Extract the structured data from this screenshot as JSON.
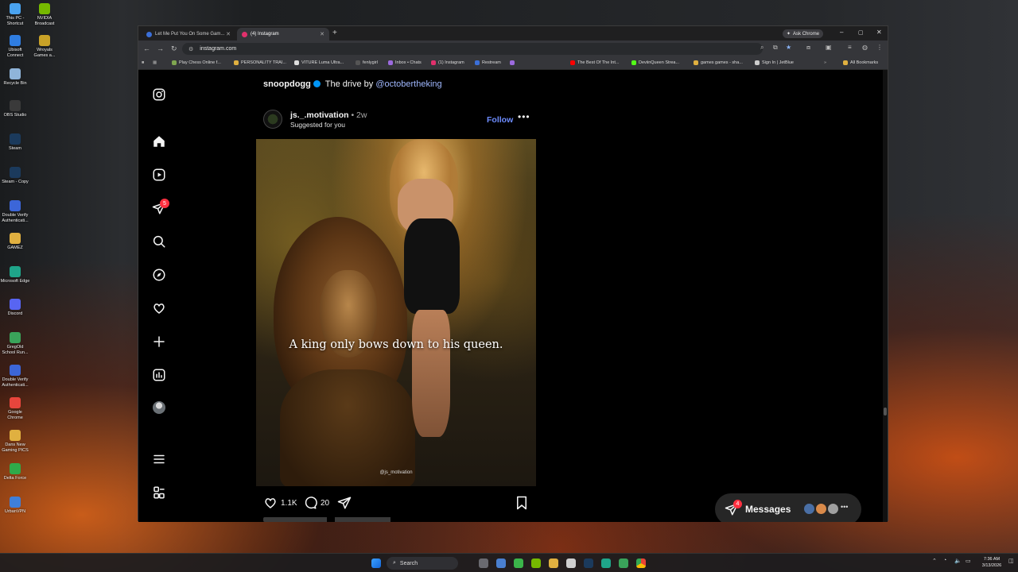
{
  "desktop": {
    "icons": [
      {
        "label": "This PC - Shortcut",
        "color": "#4aa3f0"
      },
      {
        "label": "NVIDIA Broadcast",
        "color": "#76b900"
      },
      {
        "label": "Ubisoft Connect",
        "color": "#2f7de1"
      },
      {
        "label": "Wroyals Games a...",
        "color": "#c9a227"
      },
      {
        "label": "Recycle Bin",
        "color": "#8fb4d9"
      },
      {
        "label": "OBS Studio",
        "color": "#3a3a3a"
      },
      {
        "label": "Steam",
        "color": "#1b3a5c"
      },
      {
        "label": "Steam - Copy",
        "color": "#1b3a5c"
      },
      {
        "label": "Double Verify Authenticati...",
        "color": "#3c66d8"
      },
      {
        "label": "GAMEZ",
        "color": "#e0b040"
      },
      {
        "label": "Microsoft Edge",
        "color": "#1fa58a"
      },
      {
        "label": "Discord",
        "color": "#5865f2"
      },
      {
        "label": "GregOld School Run...",
        "color": "#3aa35a"
      },
      {
        "label": "Double Verify Authenticati...",
        "color": "#3c66d8"
      },
      {
        "label": "Google Chrome",
        "color": "#e8453c"
      },
      {
        "label": "Dans New Gaming PICS",
        "color": "#e0b040"
      },
      {
        "label": "Delta Force",
        "color": "#2faa4a"
      },
      {
        "label": "UrbanVPN",
        "color": "#3f7fd9"
      }
    ]
  },
  "browser": {
    "tabs": [
      {
        "label": "Let Me Put You On Some Gam...",
        "active": false,
        "fav_color": "#3b6fd8"
      },
      {
        "label": "(4) Instagram",
        "active": true,
        "fav_color": "#e1306c"
      }
    ],
    "new_tab_symbol": "+",
    "ask_chrome": "Ask Chrome",
    "window_controls": [
      "–",
      "▢",
      "✕"
    ],
    "nav": [
      "←",
      "→",
      "↻"
    ],
    "url": "instagram.com",
    "bookmarks": [
      {
        "label": "Play Chess Online f...",
        "color": "#7fa650"
      },
      {
        "label": "PERSONALITY TRAI...",
        "color": "#e0b040"
      },
      {
        "label": "VITURE Luma Ultra...",
        "color": "#dddddd"
      },
      {
        "label": "fenlygirl",
        "color": "#444444"
      },
      {
        "label": "Inbox • Chats",
        "color": "#9c6ade"
      },
      {
        "label": "(1) Instagram",
        "color": "#e1306c"
      },
      {
        "label": "Restream",
        "color": "#3b6fd8"
      },
      {
        "label": "",
        "color": "#9c6ade"
      },
      {
        "label": "The Best Of The Int...",
        "color": "#ff0000"
      },
      {
        "label": "DeviinQueen Strea...",
        "color": "#53fc18"
      },
      {
        "label": "games games - sha...",
        "color": "#e0b040"
      },
      {
        "label": "Sign In | JetBlue",
        "color": "#cccccc"
      },
      {
        "label": "All Bookmarks",
        "color": "#e0b040"
      }
    ]
  },
  "instagram": {
    "sidebar_badge": "5",
    "prev_post": {
      "username": "snoopdogg",
      "caption_text": " The drive by ",
      "mention": "@octobertheking"
    },
    "post": {
      "username": "js._.motivation",
      "time": "2w",
      "subtitle": "Suggested for you",
      "follow": "Follow",
      "quote": "A king only bows down to his queen.",
      "watermark": "@js_motivation",
      "likes": "1.1K",
      "comments": "20"
    },
    "messages": {
      "label": "Messages",
      "badge": "4"
    }
  },
  "taskbar": {
    "search": "Search",
    "time": "7:36 AM",
    "date": "3/13/2026"
  }
}
